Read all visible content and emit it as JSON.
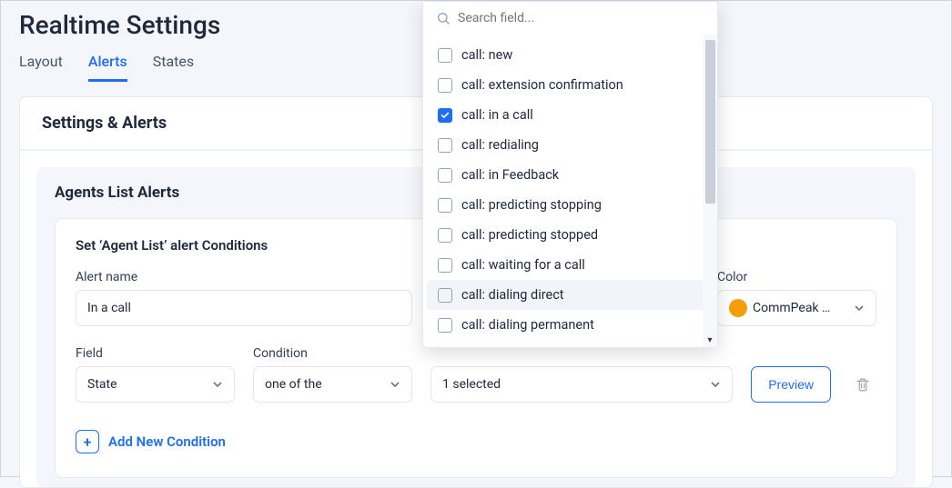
{
  "page_title": "Realtime Settings",
  "tabs": [
    "Layout",
    "Alerts",
    "States"
  ],
  "active_tab_index": 1,
  "card_header": "Settings & Alerts",
  "inner_title": "Agents List Alerts",
  "conditions_title": "Set ‘Agent List’ alert Conditions",
  "alert_name": {
    "label": "Alert name",
    "value": "In a call"
  },
  "color_select": {
    "label": "Color",
    "value": "CommPeak …",
    "swatch": "#f59e0b"
  },
  "field_select": {
    "label": "Field",
    "value": "State"
  },
  "condition_select": {
    "label": "Condition",
    "value": "one of the"
  },
  "value_select": {
    "value": "1 selected"
  },
  "preview_button": "Preview",
  "add_condition": "Add New Condition",
  "dropdown": {
    "search_placeholder": "Search field...",
    "options": [
      {
        "label": "call: new",
        "checked": false
      },
      {
        "label": "call: extension confirmation",
        "checked": false
      },
      {
        "label": "call: in a call",
        "checked": true
      },
      {
        "label": "call: redialing",
        "checked": false
      },
      {
        "label": "call: in Feedback",
        "checked": false
      },
      {
        "label": "call: predicting stopping",
        "checked": false
      },
      {
        "label": "call: predicting stopped",
        "checked": false
      },
      {
        "label": "call: waiting for a call",
        "checked": false
      },
      {
        "label": "call: dialing direct",
        "checked": false,
        "hover": true
      },
      {
        "label": "call: dialing permanent",
        "checked": false
      }
    ]
  }
}
